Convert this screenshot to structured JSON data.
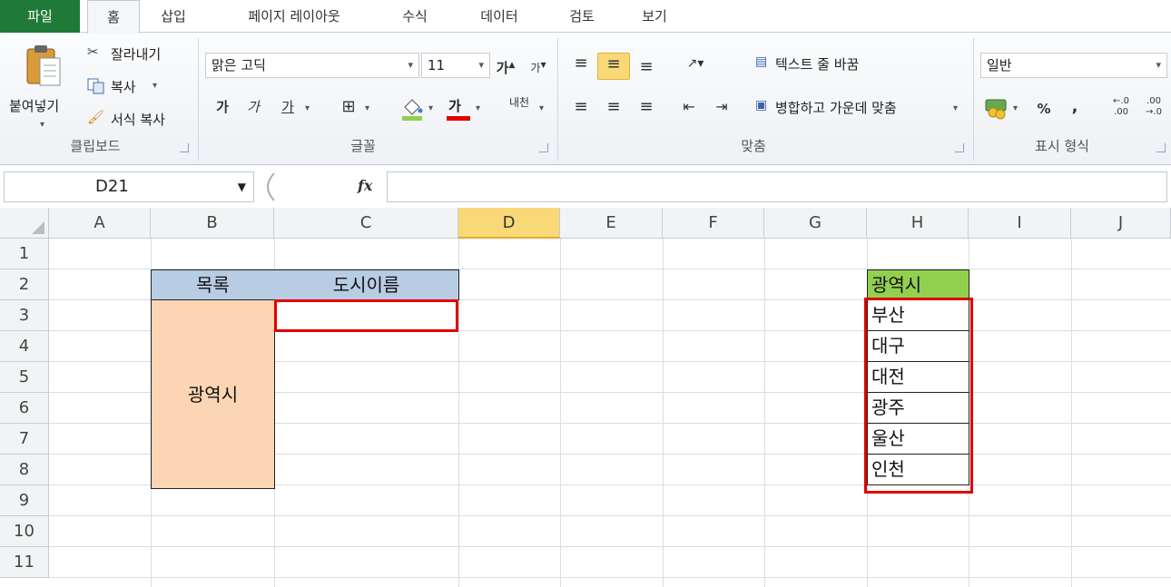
{
  "tabs": [
    "파일",
    "홈",
    "삽입",
    "페이지 레이아웃",
    "수식",
    "데이터",
    "검토",
    "보기"
  ],
  "ribbon": {
    "clipboard": {
      "paste": "붙여넣기",
      "cut": "잘라내기",
      "copy": "복사",
      "format_painter": "서식 복사",
      "label": "클립보드"
    },
    "font": {
      "name": "맑은 고딕",
      "size": "11",
      "grow": "가",
      "shrink": "가",
      "bold": "가",
      "italic": "가",
      "underline": "가",
      "font_color_glyph": "가",
      "phonetic": "내천",
      "label": "글꼴"
    },
    "alignment": {
      "wrap_text": "텍스트 줄 바꿈",
      "merge_center": "병합하고 가운데 맞춤",
      "label": "맞춤"
    },
    "number": {
      "format": "일반",
      "percent": "%",
      "comma": ",",
      "inc_decimal": "←.0 .00",
      "dec_decimal": ".00 →.0",
      "label": "표시 형식"
    }
  },
  "formula_bar": {
    "name_box": "D21",
    "fx": "fx",
    "content": ""
  },
  "sheet": {
    "columns": [
      "A",
      "B",
      "C",
      "D",
      "E",
      "F",
      "G",
      "H",
      "I",
      "J"
    ],
    "selected_column": "D",
    "rows": [
      "1",
      "2",
      "3",
      "4",
      "5",
      "6",
      "7",
      "8",
      "9",
      "10",
      "11"
    ],
    "b2": "목록",
    "c2": "도시이름",
    "b3_merged": "광역시",
    "h2": "광역시",
    "h_items": [
      "부산",
      "대구",
      "대전",
      "광주",
      "울산",
      "인천"
    ]
  },
  "colors": {
    "file_tab": "#1f7a38",
    "header_fill": "#b8cce4",
    "peach_fill": "#fcd5b4",
    "green_fill": "#92d050",
    "highlight_box": "#e00000"
  }
}
